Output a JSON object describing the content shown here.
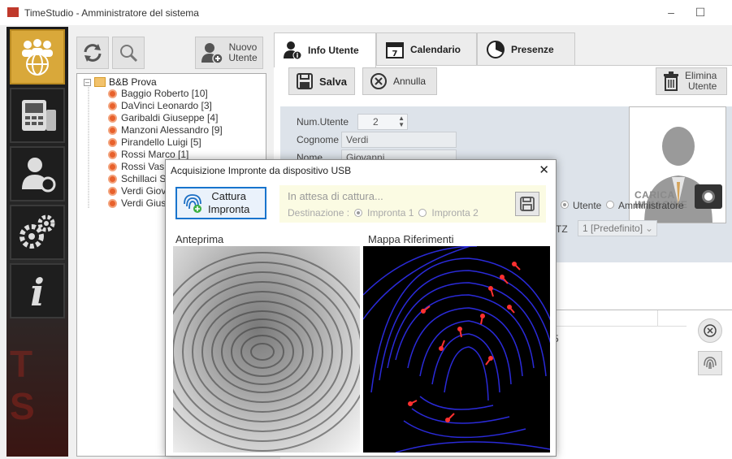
{
  "window": {
    "title": "TimeStudio - Amministratore del sistema"
  },
  "left_nav": [
    {
      "icon": "users-globe-icon"
    },
    {
      "icon": "terminal-device-icon"
    },
    {
      "icon": "user-key-icon"
    },
    {
      "icon": "gears-icon"
    },
    {
      "icon": "info-icon"
    }
  ],
  "tree_toolbar": {
    "new_user_line1": "Nuovo",
    "new_user_line2": "Utente"
  },
  "tree": {
    "root": "B&B Prova",
    "items": [
      "Baggio Roberto [10]",
      "DaVinci Leonardo [3]",
      "Garibaldi Giuseppe [4]",
      "Manzoni Alessandro [9]",
      "Pirandello Luigi [5]",
      "Rossi Marco [1]",
      "Rossi Vas",
      "Schillaci S",
      "Verdi Giov",
      "Verdi Gius"
    ]
  },
  "tabs": [
    {
      "label": "Info Utente",
      "icon": "user-info-icon"
    },
    {
      "label": "Calendario",
      "icon": "calendar-icon"
    },
    {
      "label": "Presenze",
      "icon": "clock-icon"
    }
  ],
  "actions": {
    "save": "Salva",
    "cancel": "Annulla",
    "delete_line1": "Elimina",
    "delete_line2": "Utente"
  },
  "form": {
    "num_label": "Num.Utente",
    "num_value": "2",
    "surname_label": "Cognome",
    "surname_value": "Verdi",
    "name_label": "Nome",
    "name_value": "Giovanni",
    "privileges_partial": "legi",
    "priv_user": "Utente",
    "priv_admin": "Amministratore",
    "tz_partial": "TZ",
    "tz_value": "1 [Predefinito]",
    "photo_caption_line1": "CARICA",
    "photo_caption_line2": "IMMAGINE",
    "list_partial": "5"
  },
  "dialog": {
    "title": "Acquisizione Impronte da dispositivo USB",
    "capture_line1": "Cattura",
    "capture_line2": "Impronta",
    "waiting": "In attesa di cattura...",
    "destination_label": "Destinazione :",
    "option1": "Impronta 1",
    "option2": "Impronta 2",
    "preview_label": "Anteprima",
    "map_label": "Mappa Riferimenti"
  },
  "colors": {
    "accent_blue": "#1874cd",
    "nav_active": "#d9a83a",
    "minutiae": "#ff3030",
    "ridges": "#2a2ad8"
  }
}
